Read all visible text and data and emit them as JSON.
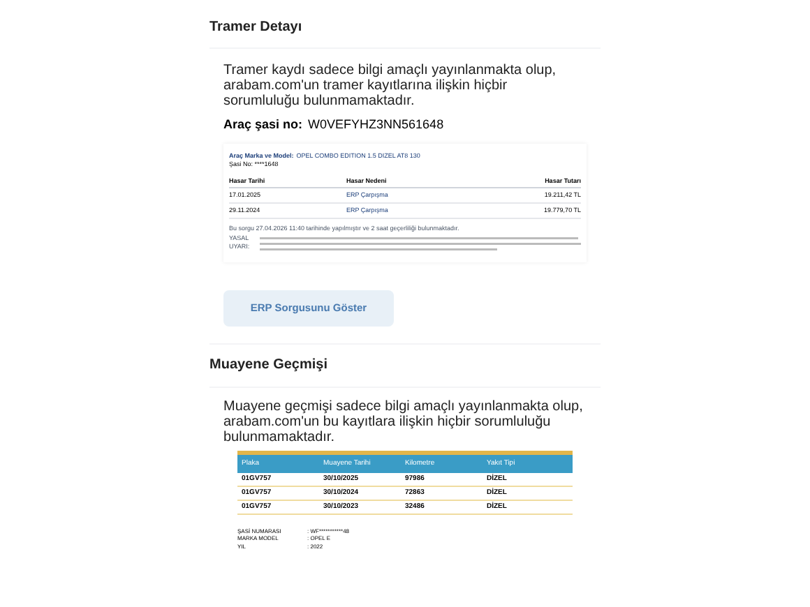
{
  "tramer": {
    "title": "Tramer Detayı",
    "notice": "Tramer kaydı sadece bilgi amaçlı yayınlanmakta olup, arabam.com'un tramer kayıtlarına ilişkin hiçbir sorumluluğu bulunmamaktadır.",
    "chassis_label": "Araç şasi no:",
    "chassis_value": "W0VEFYHZ3NN561648",
    "report": {
      "model_label": "Araç Marka ve Model:",
      "model_value": "OPEL COMBO EDITION 1.5 DIZEL AT8 130",
      "chassis": "Şasi No: ****1648",
      "columns": [
        "Hasar Tarihi",
        "Hasar Nedeni",
        "Hasar Tutarı"
      ],
      "rows": [
        {
          "date": "17.01.2025",
          "reason": "ERP Çarpışma",
          "amount": "19.211,42 TL"
        },
        {
          "date": "29.11.2024",
          "reason": "ERP Çarpışma",
          "amount": "19.779,70 TL"
        }
      ],
      "query_note": "Bu sorgu 27.04.2026 11:40 tarihinde yapılmıştır ve 2 saat geçerliliği bulunmaktadır.",
      "legal_label": "YASAL UYARI:"
    },
    "button": "ERP Sorgusunu Göster"
  },
  "inspection": {
    "title": "Muayene Geçmişi",
    "notice": "Muayene geçmişi sadece bilgi amaçlı yayınlanmakta olup, arabam.com'un bu kayıtlara ilişkin hiçbir sorumluluğu bulunmamaktadır.",
    "columns": [
      "Plaka",
      "Muayene Tarihi",
      "Kilometre",
      "Yakıt Tipi"
    ],
    "rows": [
      [
        "01GV757",
        "30/10/2025",
        "97986",
        "DİZEL"
      ],
      [
        "01GV757",
        "30/10/2024",
        "72863",
        "DİZEL"
      ],
      [
        "01GV757",
        "30/10/2023",
        "32486",
        "DİZEL"
      ]
    ],
    "info": [
      {
        "label": "ŞASİ NUMARASI",
        "value": ": WF***********48"
      },
      {
        "label": "MARKA MODEL",
        "value": ": OPEL E"
      },
      {
        "label": "YIL",
        "value": ": 2022"
      }
    ]
  }
}
